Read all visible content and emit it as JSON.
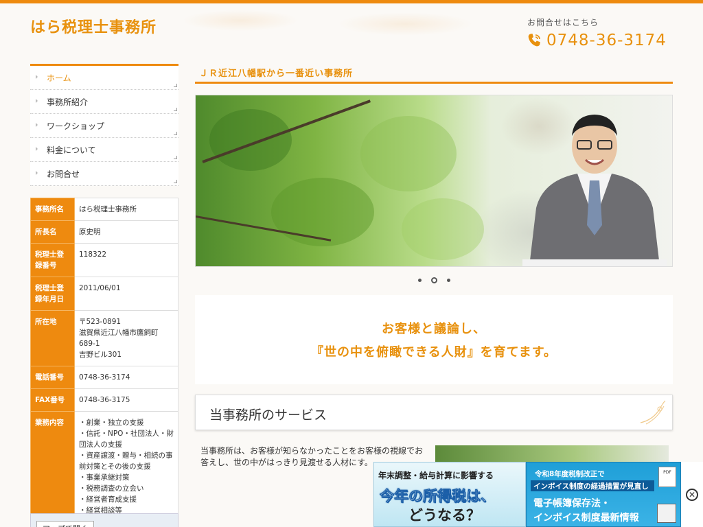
{
  "header": {
    "site_title": "はら税理士事務所",
    "contact_label": "お問合せはこちら",
    "phone": "0748-36-3174",
    "accent_color": "#ee8a0f",
    "phone_icon": "phone-icon"
  },
  "nav": {
    "items": [
      {
        "label": "ホーム",
        "active": true
      },
      {
        "label": "事務所紹介",
        "active": false
      },
      {
        "label": "ワークショップ",
        "active": false
      },
      {
        "label": "料金について",
        "active": false
      },
      {
        "label": "お問合せ",
        "active": false
      }
    ]
  },
  "office_info": {
    "rows": [
      {
        "key": "事務所名",
        "value": [
          "はら税理士事務所"
        ]
      },
      {
        "key": "所長名",
        "value": [
          "原史明"
        ]
      },
      {
        "key": "税理士登録番号",
        "value": [
          "118322"
        ]
      },
      {
        "key": "税理士登録年月日",
        "value": [
          "2011/06/01"
        ]
      },
      {
        "key": "所在地",
        "value": [
          "〒523-0891",
          "滋賀県近江八幡市鷹飼町",
          "689-1",
          "吉野ビル301"
        ]
      },
      {
        "key": "電話番号",
        "value": [
          "0748-36-3174"
        ]
      },
      {
        "key": "FAX番号",
        "value": [
          "0748-36-3175"
        ]
      },
      {
        "key": "業務内容",
        "value": [
          "・創業・独立の支援",
          "・信託・NPO・社団法人・財",
          "団法人の支援",
          "・資産譲渡・贈与・相続の事",
          "前対策とその後の支援",
          "・事業承継対策",
          "・税務調査の立会い",
          "・経営者育成支援",
          "・経営相談等"
        ]
      }
    ],
    "map_button": "マップで開く"
  },
  "main": {
    "heading": "ＪＲ近江八幡駅から一番近い事務所",
    "slider_dots": 3,
    "slider_active_dot": 1,
    "tagline_line1": "お客様と議論し、",
    "tagline_line2": "『世の中を俯瞰できる人財』を育てます。",
    "service_title": "当事務所のサービス",
    "service_text": "当事務所は、お客様が知らなかったことをお客様の視線でお答えし、世の中がはっきり見渡せる人材にす。"
  },
  "banner": {
    "left_line1": "年末調整・給与計算に影響する",
    "left_line2": "今年の所得税は、",
    "left_line3": "どうなる？",
    "right_line1": "令和8年度税制改正で",
    "right_line2": "インボイス制度の経過措置が見直し",
    "right_line3": "電子帳簿保存法・",
    "right_line4": "インボイス制度最新情報",
    "pdf_label": "PDF",
    "close_icon": "close-icon"
  }
}
